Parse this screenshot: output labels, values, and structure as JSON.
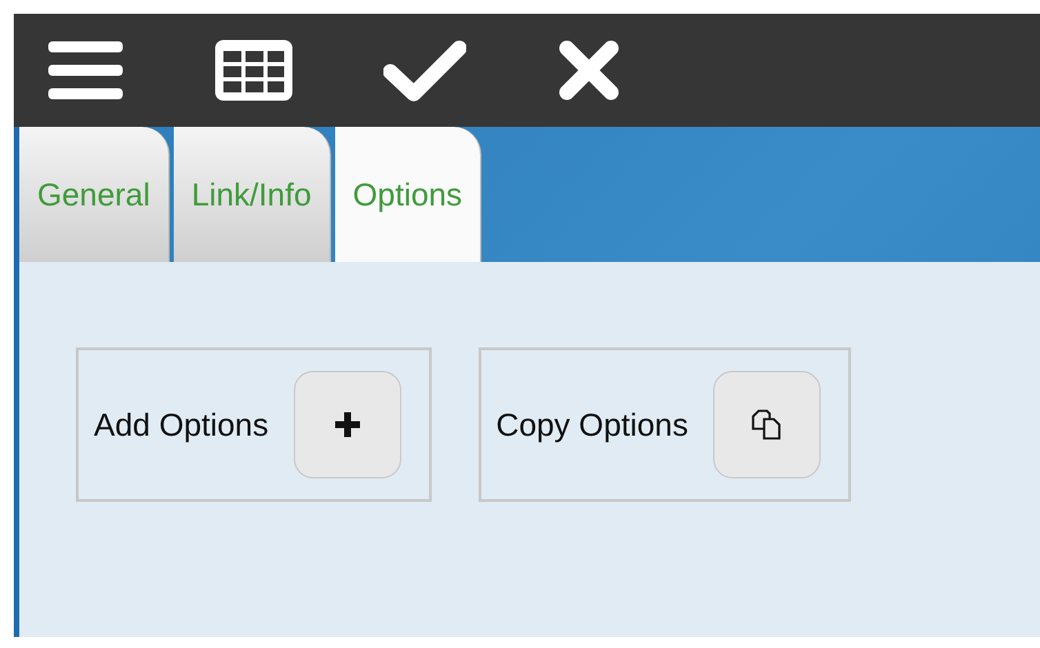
{
  "tabs": [
    {
      "label": "General",
      "selected": false
    },
    {
      "label": "Link/Info",
      "selected": false
    },
    {
      "label": "Options",
      "selected": true
    }
  ],
  "actions": [
    {
      "label": "Add Options"
    },
    {
      "label": "Copy Options"
    }
  ]
}
